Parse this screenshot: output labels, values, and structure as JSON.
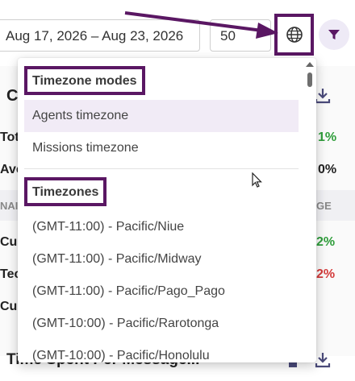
{
  "toolbar": {
    "date_range": "Aug 17, 2026 – Aug 23, 2026",
    "page_size": "50",
    "timezone_icon": "globe-icon",
    "filter_icon": "filter-icon"
  },
  "background": {
    "card_title_fragment": "C",
    "row_labels": [
      "Tot",
      "Ave",
      "Cus",
      "Tec",
      "Cus"
    ],
    "header_left": "NAI",
    "header_right": "GE",
    "percent_fragments": [
      "1%",
      "0%",
      "2%",
      "2%"
    ],
    "bottom_title": "Time Spent Per Message..."
  },
  "dropdown": {
    "modes_heading": "Timezone modes",
    "modes": [
      "Agents timezone",
      "Missions timezone"
    ],
    "timezones_heading": "Timezones",
    "timezones": [
      "(GMT-11:00) - Pacific/Niue",
      "(GMT-11:00) - Pacific/Midway",
      "(GMT-11:00) - Pacific/Pago_Pago",
      "(GMT-10:00) - Pacific/Rarotonga",
      "(GMT-10:00) - Pacific/Honolulu"
    ]
  },
  "colors": {
    "annotation": "#5a1763",
    "accent": "#5a1763",
    "selected_option_bg": "#f1ebf6",
    "positive": "#2e9d3a",
    "negative": "#d33a3a"
  }
}
